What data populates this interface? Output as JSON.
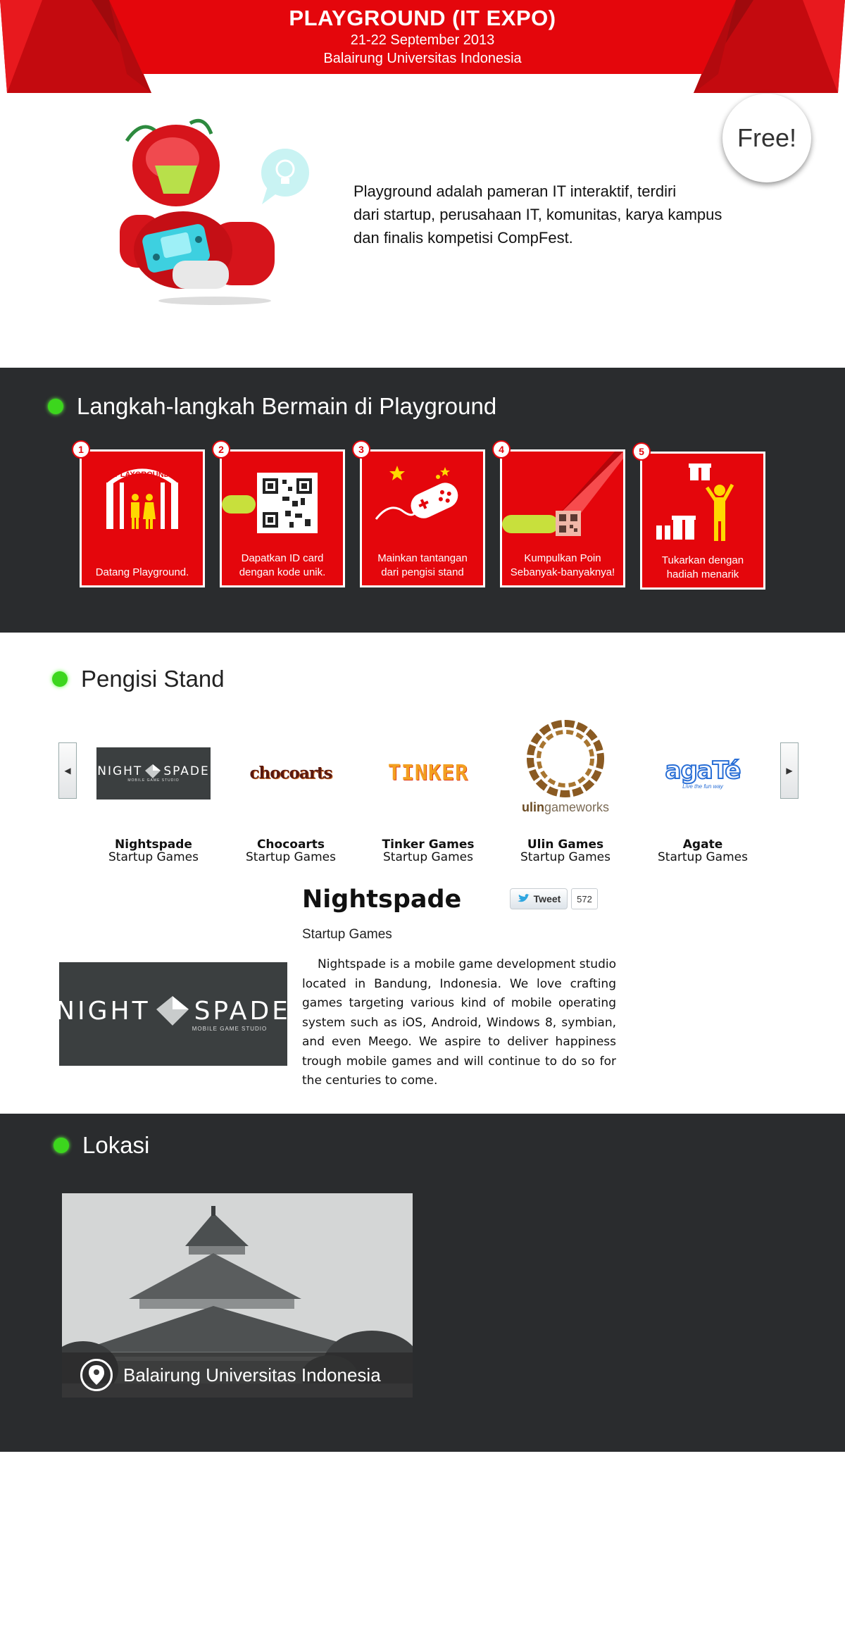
{
  "header": {
    "title": "PLAYGROUND (IT EXPO)",
    "date": "21-22 September 2013",
    "venue": "Balairung Universitas Indonesia",
    "ribbon_color": "#e4060c"
  },
  "intro": {
    "badge": "Free!",
    "lines": [
      "Playground adalah pameran IT interaktif, terdiri",
      "dari startup, perusahaan IT, komunitas, karya kampus",
      "dan finalis kompetisi CompFest."
    ]
  },
  "steps_section": {
    "title": "Langkah-langkah Bermain di Playground",
    "steps": [
      {
        "num": "1",
        "caption": [
          "Datang Playground."
        ],
        "sign": "PLAYGROUND"
      },
      {
        "num": "2",
        "caption": [
          "Dapatkan ID card",
          "dengan kode unik."
        ]
      },
      {
        "num": "3",
        "caption": [
          "Mainkan tantangan",
          "dari pengisi stand"
        ]
      },
      {
        "num": "4",
        "caption": [
          "Kumpulkan Poin",
          "Sebanyak-banyaknya!"
        ]
      },
      {
        "num": "5",
        "caption": [
          "Tukarkan dengan",
          "hadiah menarik"
        ]
      }
    ]
  },
  "stand_section": {
    "title": "Pengisi Stand",
    "prev_icon": "◀",
    "next_icon": "▶",
    "sponsors": [
      {
        "name": "Nightspade",
        "category": "Startup Games",
        "logo_words": [
          "NIGHT",
          "SPADE"
        ],
        "logo_sub": "MOBILE GAME STUDIO"
      },
      {
        "name": "Chocoarts",
        "category": "Startup Games",
        "logo_text": "chocoarts"
      },
      {
        "name": "Tinker Games",
        "category": "Startup Games",
        "logo_text": "TINKER"
      },
      {
        "name": "Ulin Games",
        "category": "Startup Games",
        "logo_text_a": "ulin",
        "logo_text_b": "gameworks"
      },
      {
        "name": "Agate",
        "category": "Startup Games",
        "logo_text": "agaTé",
        "logo_tagline": "Live the fun way"
      }
    ],
    "detail": {
      "name": "Nightspade",
      "category": "Startup Games",
      "tweet_label": "Tweet",
      "tweet_count": "572",
      "description": "Nightspade is a mobile game development studio located in Bandung, Indonesia. We love crafting games targeting various kind of mobile operating system such as iOS, Android, Windows 8, symbian, and even Meego. We aspire to deliver happiness trough mobile games and will continue to do so for the centuries to come."
    }
  },
  "location_section": {
    "title": "Lokasi",
    "place": "Balairung Universitas Indonesia"
  }
}
